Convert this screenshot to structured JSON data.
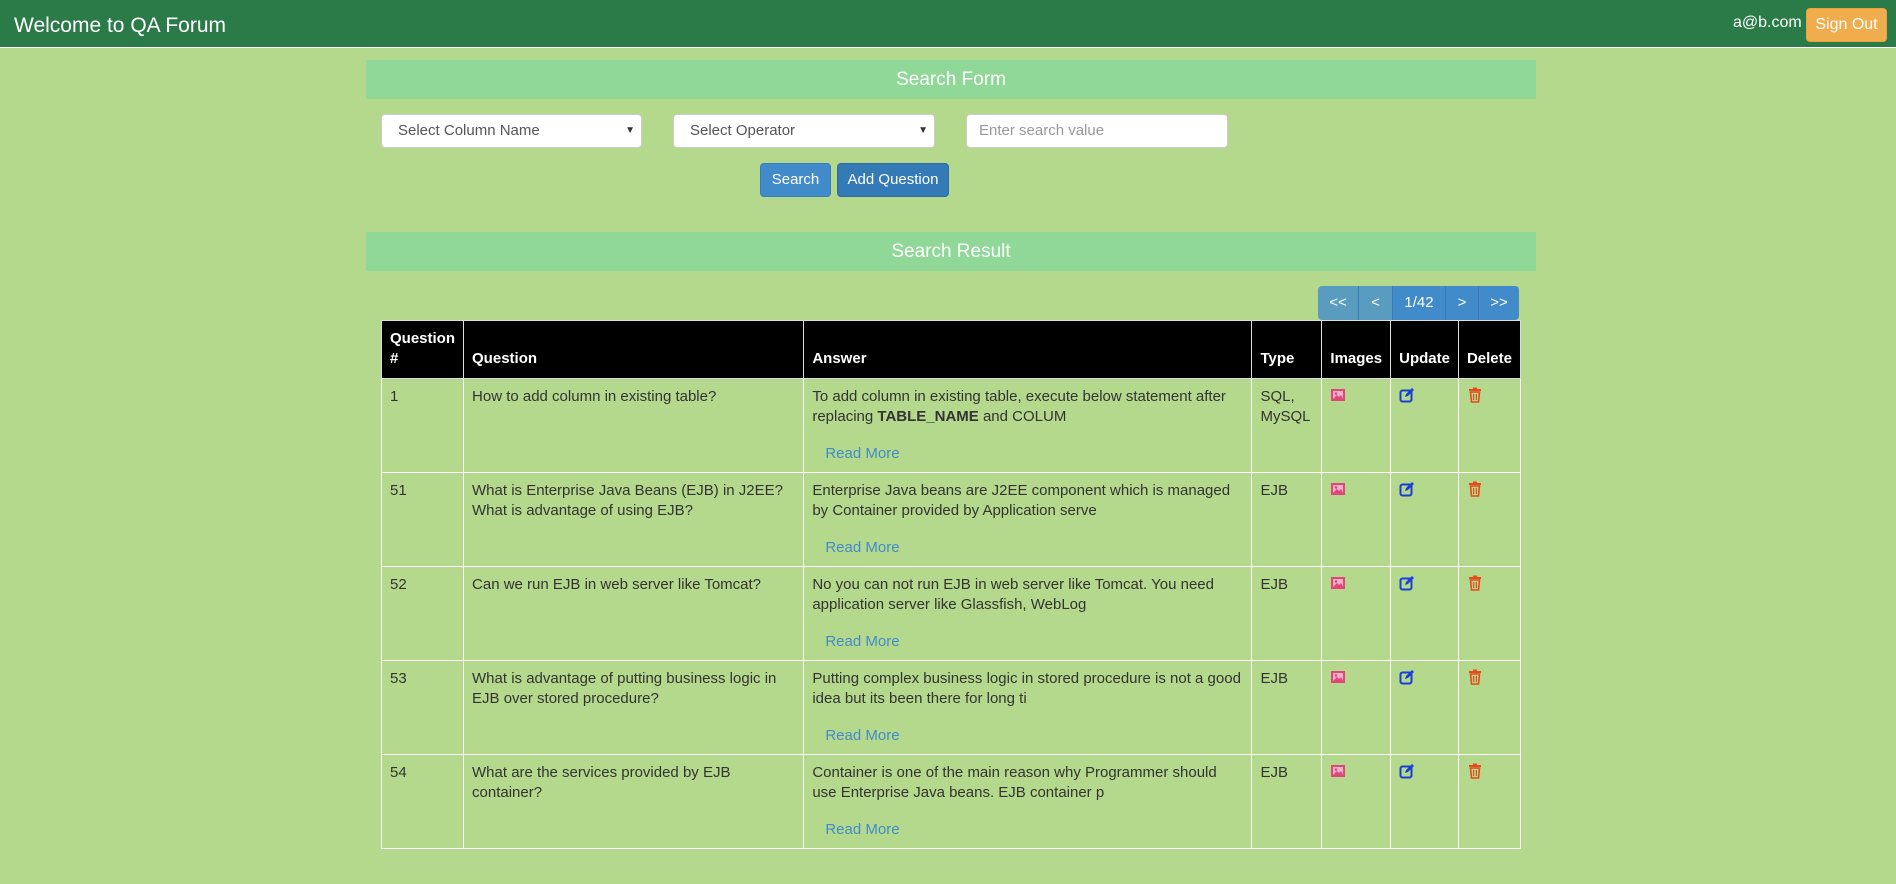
{
  "header": {
    "brand": "Welcome to QA Forum",
    "user_email": "a@b.com",
    "signout_label": "Sign Out"
  },
  "search_form": {
    "title": "Search Form",
    "column_select": "Select Column Name",
    "operator_select": "Select Operator",
    "value_placeholder": "Enter search value",
    "search_label": "Search",
    "add_label": "Add Question"
  },
  "results": {
    "title": "Search Result",
    "pager": {
      "first": "<<",
      "prev": "<",
      "current": "1/42",
      "next": ">",
      "last": ">>"
    },
    "columns": [
      "Question #",
      "Question",
      "Answer",
      "Type",
      "Images",
      "Update",
      "Delete"
    ],
    "read_more_label": "Read More",
    "rows": [
      {
        "id": "1",
        "question": "How to add column in existing table?",
        "answer_pre": "To add column in existing table, execute below statement after replacing ",
        "answer_bold": "TABLE_NAME",
        "answer_post": " and COLUM",
        "type": "SQL, MySQL"
      },
      {
        "id": "51",
        "question": "What is Enterprise Java Beans (EJB) in J2EE? What is advantage of using EJB?",
        "answer_pre": "Enterprise Java beans are J2EE component which is managed by Container provided by Application serve",
        "answer_bold": "",
        "answer_post": "",
        "type": "EJB"
      },
      {
        "id": "52",
        "question": "Can we run EJB in web server like Tomcat?",
        "answer_pre": "No you can not run EJB in web server like Tomcat. You need application server like Glassfish, WebLog",
        "answer_bold": "",
        "answer_post": "",
        "type": "EJB"
      },
      {
        "id": "53",
        "question": "What is advantage of putting business logic in EJB over stored procedure?",
        "answer_pre": "Putting complex business logic in stored procedure is not a good idea but its been there for long ti",
        "answer_bold": "",
        "answer_post": "",
        "type": "EJB"
      },
      {
        "id": "54",
        "question": "What are the services provided by EJB container?",
        "answer_pre": "Container is one of the main reason why Programmer should use Enterprise Java beans. EJB container p",
        "answer_bold": "",
        "answer_post": "",
        "type": "EJB"
      }
    ]
  },
  "colors": {
    "header_bg": "#2b7b48",
    "page_bg": "#b5d98c",
    "section_bar": "#8fd897",
    "signout": "#f0ad4e",
    "primary": "#428bca",
    "image_icon": "#e0457b",
    "edit_icon": "#1a3fd6",
    "delete_icon": "#e8491d"
  },
  "icons": {
    "images": "picture-icon",
    "update": "edit-icon",
    "delete": "trash-icon"
  }
}
